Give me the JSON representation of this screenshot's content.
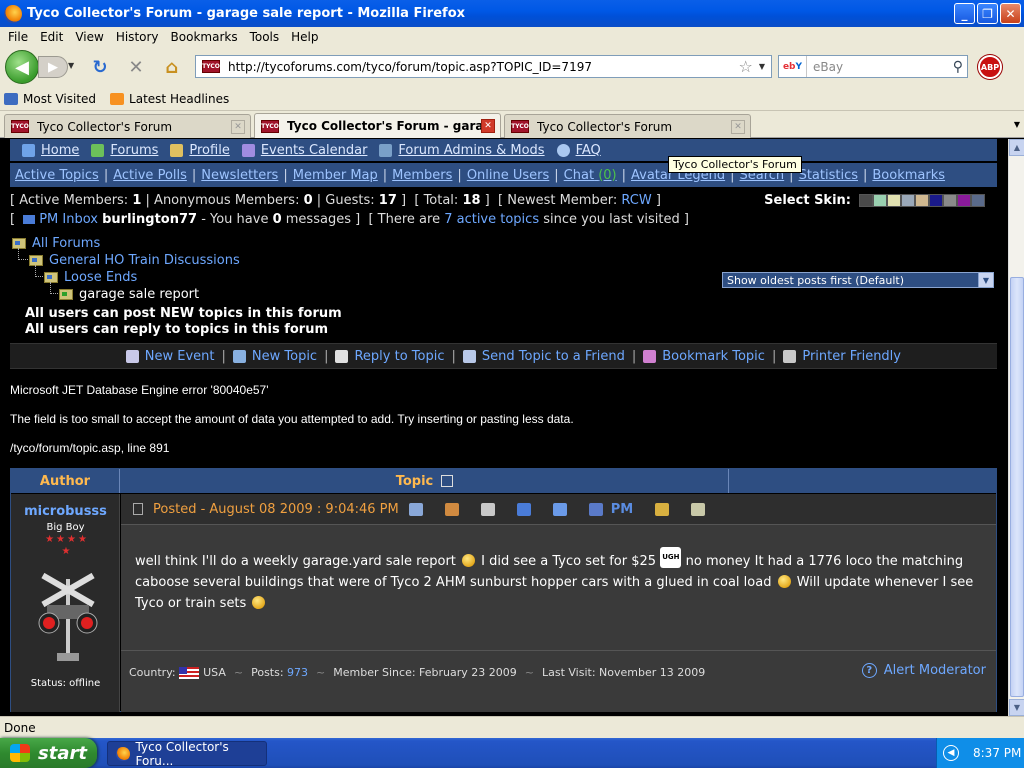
{
  "window": {
    "title": "Tyco Collector's Forum - garage sale report - Mozilla Firefox"
  },
  "menu": [
    "File",
    "Edit",
    "View",
    "History",
    "Bookmarks",
    "Tools",
    "Help"
  ],
  "toolbar": {
    "url": "http://tycoforums.com/tyco/forum/topic.asp?TOPIC_ID=7197",
    "search_placeholder": "eBay",
    "search_engine": "ebY",
    "abp_label": "ABP",
    "favicon_text": "TYCO"
  },
  "bookmarks": [
    "Most Visited",
    "Latest Headlines"
  ],
  "tabs": [
    {
      "label": "Tyco Collector's Forum",
      "active": false
    },
    {
      "label": "Tyco Collector's Forum - garage ...",
      "active": true
    },
    {
      "label": "Tyco Collector's Forum",
      "active": false
    }
  ],
  "forum": {
    "top_nav": [
      {
        "label": "Home",
        "icon": "home-icon",
        "color": "#6fa3e8"
      },
      {
        "label": "Forums",
        "icon": "forums-icon",
        "color": "#6cc05a"
      },
      {
        "label": "Profile",
        "icon": "profile-icon",
        "color": "#e0c060"
      },
      {
        "label": "Events Calendar",
        "icon": "calendar-icon",
        "color": "#a08ce0"
      },
      {
        "label": "Forum Admins & Mods",
        "icon": "admins-icon",
        "color": "#7aa0c8"
      },
      {
        "label": "FAQ",
        "icon": "faq-icon",
        "color": "#aac8f0"
      }
    ],
    "tooltip": "Tyco Collector's Forum",
    "sub_nav": [
      "Active Topics",
      "Active Polls",
      "Newsletters",
      "Member Map",
      "Members",
      "Online Users",
      "Chat",
      "Avatar Legend",
      "Search",
      "Statistics",
      "Bookmarks"
    ],
    "chat_count": "(0)",
    "stats": {
      "active_label": "Active Members:",
      "active": "1",
      "anon_label": "Anonymous Members:",
      "anon": "0",
      "guests_label": "Guests:",
      "guests": "17",
      "total_label": "Total:",
      "total": "18",
      "newest_label": "Newest Member:",
      "newest": "RCW"
    },
    "skin_label": "Select Skin:",
    "skin_colors": [
      "#4a4a4a",
      "#9ad0b0",
      "#e0e0b0",
      "#9aa8b8",
      "#d0b890",
      "#1a1a8a",
      "#8a8a8a",
      "#8a1a9a",
      "#5a6a8a"
    ],
    "pm": {
      "label": "PM Inbox",
      "user": "burlington77",
      "msg_a": " - You have ",
      "count": "0",
      "msg_b": " messages",
      "active_pre": "There are ",
      "active_topics": "7 active topics",
      "active_post": " since you last visited"
    },
    "breadcrumb": [
      "All Forums",
      "General HO Train Discussions",
      "Loose Ends",
      "garage sale report"
    ],
    "sort_option": "Show oldest posts first  (Default)",
    "permissions": [
      "All users can post NEW topics in this forum",
      "All users can reply to topics in this forum"
    ],
    "actions": [
      {
        "label": "New Event",
        "color": "#c8c8e8"
      },
      {
        "label": "New Topic",
        "color": "#88b0e0"
      },
      {
        "label": "Reply to Topic",
        "color": "#e0e0e0"
      },
      {
        "label": "Send Topic to a Friend",
        "color": "#b8c8e8"
      },
      {
        "label": "Bookmark Topic",
        "color": "#d080d0"
      },
      {
        "label": "Printer Friendly",
        "color": "#c8c8c8"
      }
    ],
    "error": {
      "line1": "Microsoft JET Database Engine error '80040e57'",
      "line2": "The field is too small to accept the amount of data you attempted to add. Try inserting or pasting less data.",
      "line3": "/tyco/forum/topic.asp, line 891"
    },
    "table": {
      "author_header": "Author",
      "topic_header": "Topic"
    },
    "post": {
      "author": "microbusss",
      "rank": "Big Boy",
      "stars": 5,
      "status": "Status: offline",
      "posted": "Posted - August 08 2009 :  9:04:46 PM",
      "pm_label": "PM",
      "msg1": "well think I'll do a weekly garage.yard sale report",
      "msg2": " I did see a Tyco set for $25 ",
      "ugh": "UGH",
      "msg3": " no money It had a 1776 loco the matching caboose several buildings that were of Tyco 2 AHM sunburst hopper cars with a glued in coal load",
      "msg4": " Will update whenever I see Tyco or train sets",
      "country_label": "Country:",
      "country": "USA",
      "posts_label": "Posts:",
      "posts": "973",
      "member_since": "Member Since: February 23 2009",
      "last_visit": "Last Visit: November 13 2009",
      "alert": "Alert Moderator"
    }
  },
  "statusbar": {
    "text": "Done"
  },
  "taskbar": {
    "start": "start",
    "item": "Tyco Collector's Foru...",
    "clock": "8:37 PM"
  }
}
